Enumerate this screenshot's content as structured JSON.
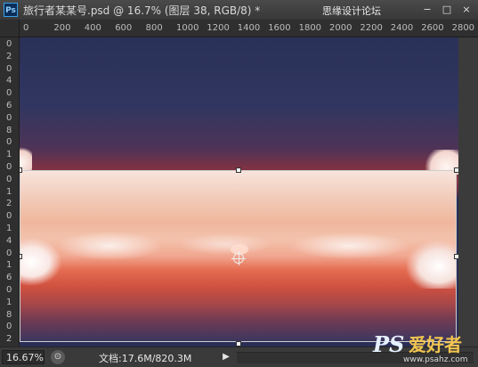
{
  "window": {
    "app_icon": "Ps",
    "title": "旅行者某某号.psd @ 16.7% (图层 38, RGB/8) *",
    "watermark": "思缘设计论坛",
    "controls": {
      "minimize": "−",
      "maximize": "□",
      "close": "×"
    }
  },
  "rulers": {
    "horizontal": [
      "0",
      "200",
      "400",
      "600",
      "800",
      "1000",
      "1200",
      "1400",
      "1600",
      "1800",
      "2000",
      "2200",
      "2400",
      "2600",
      "2800"
    ],
    "vertical": [
      "0",
      "2",
      "0",
      "4",
      "0",
      "6",
      "0",
      "8",
      "0",
      "1",
      "0",
      "0",
      "1",
      "2",
      "0",
      "1",
      "4",
      "0",
      "1",
      "6",
      "0",
      "1",
      "8",
      "0",
      "2"
    ]
  },
  "statusbar": {
    "zoom": "16.67%",
    "doc_info": "文档:17.6M/820.3M",
    "arrow": "▶"
  },
  "logo": {
    "ps": "PS",
    "cn": "爱好者",
    "url": "www.psahz.com"
  },
  "icons": {
    "app": "photoshop-icon",
    "export": "export-icon",
    "arrow": "play-arrow-icon"
  }
}
